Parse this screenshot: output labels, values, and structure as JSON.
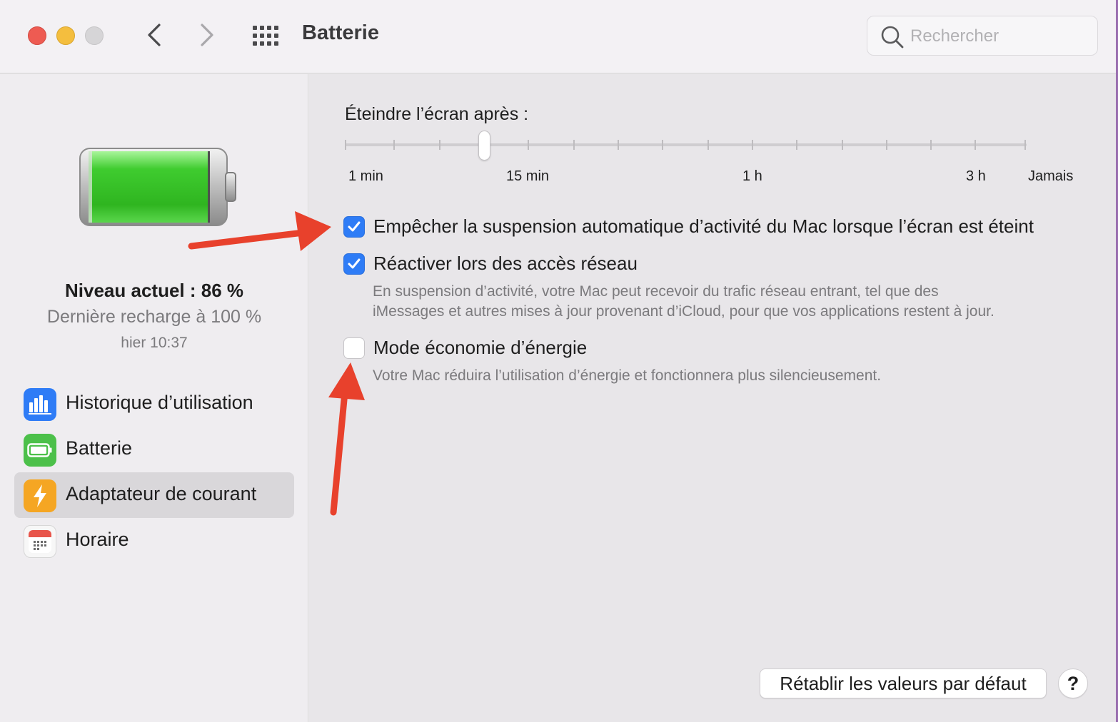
{
  "window": {
    "title": "Batterie"
  },
  "search": {
    "placeholder": "Rechercher"
  },
  "battery_status": {
    "level": "Niveau actuel : 86 %",
    "last_charge": "Dernière recharge à 100 %",
    "time": "hier 10:37",
    "level_fraction": 0.86
  },
  "sidebar": {
    "items": [
      {
        "label": "Historique d’utilisation",
        "icon": "bar-chart-icon",
        "color": "#2f7cf6"
      },
      {
        "label": "Batterie",
        "icon": "battery-icon",
        "color": "#4cc04a"
      },
      {
        "label": "Adaptateur de courant",
        "icon": "bolt-icon",
        "color": "#f5a623",
        "selected": true
      },
      {
        "label": "Horaire",
        "icon": "calendar-icon",
        "color": "#e8554b"
      }
    ]
  },
  "display_sleep": {
    "label": "Éteindre l’écran après :",
    "tick_labels": [
      "1 min",
      "15 min",
      "1 h",
      "3 h",
      "Jamais"
    ],
    "tick_count": 16,
    "selected_tick_index": 3
  },
  "options": {
    "prevent_sleep": {
      "label": "Empêcher la suspension automatique d’activité du Mac lorsque l’écran est éteint",
      "checked": true
    },
    "wake_network": {
      "label": "Réactiver lors des accès réseau",
      "checked": true,
      "desc1": "En suspension d’activité, votre Mac peut recevoir du trafic réseau entrant, tel que des",
      "desc2": "iMessages et autres mises à jour provenant d’iCloud, pour que vos applications restent à jour."
    },
    "low_power": {
      "label": "Mode économie d’énergie",
      "checked": false,
      "desc": "Votre Mac réduira l’utilisation d’énergie et fonctionnera plus silencieusement."
    }
  },
  "buttons": {
    "reset": "Rétablir les valeurs par défaut",
    "help": "?"
  },
  "colors": {
    "accent": "#2e7cf6",
    "annotation_arrow": "#e8412c",
    "battery_green": "#3fcc2f"
  }
}
